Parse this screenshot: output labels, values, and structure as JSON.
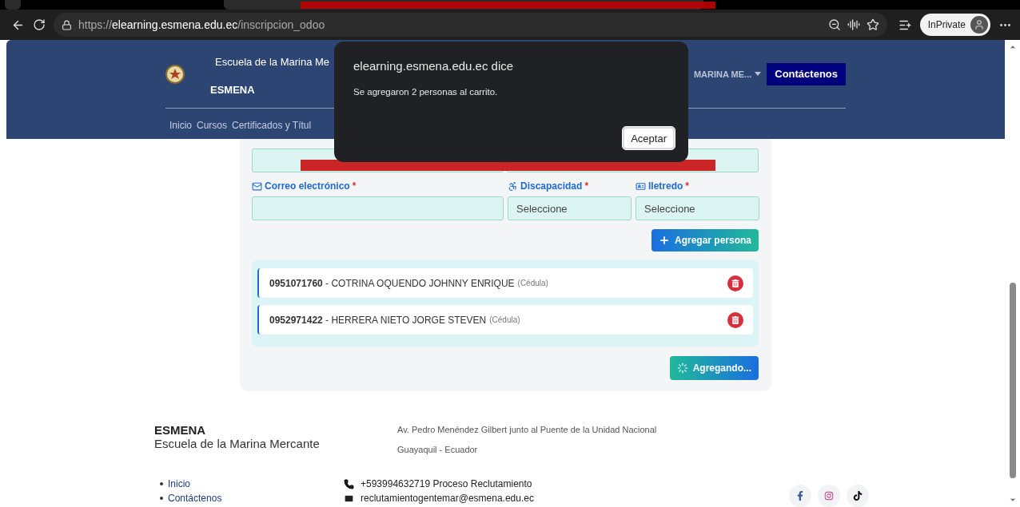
{
  "browser": {
    "url": "https://**elearning.esmena.edu.ec**/inscripcion_odoo",
    "profile": "InPrivate"
  },
  "header": {
    "site_title": "Escuela de la Marina Me",
    "brand": "ESMENA",
    "dropdown": "MARINA ME...",
    "contact_button": "Contáctenos",
    "nav": [
      "Inicio",
      "Cursos",
      "Certificados y Títul"
    ]
  },
  "form": {
    "top_inputs": [
      {
        "kind": "text"
      },
      {
        "kind": "text"
      }
    ],
    "fields": [
      {
        "kind": "email",
        "label": "Correo electrónico",
        "mark": "*"
      },
      {
        "kind": "disability",
        "label": "Discapacidad",
        "mark": "*",
        "value": "Seleccione"
      },
      {
        "kind": "illiterate",
        "label": "Iletredo",
        "mark": "*",
        "value": "Seleccione"
      }
    ],
    "add_button": "Agregar persona",
    "persons": [
      {
        "text": "**0951071760** - COTRINA OQUENDO JOHNNY ENRIQUE",
        "doc_type": "(Cédula)"
      },
      {
        "text": "**0952971422** - HERRERA NIETO JORGE STEVEN",
        "doc_type": "(Cédula)"
      }
    ],
    "submit_button": {
      "label": "Agregando...",
      "busy": true
    }
  },
  "footer": {
    "brand": "ESMENA",
    "subtitle": "Escuela de la Marina Mercante",
    "address": [
      "Av. Pedro Menéndez Gilbert junto al Puente de la Unidad Nacional",
      "Guayaquil - Ecuador"
    ],
    "links": [
      "Inicio",
      "Contáctenos"
    ],
    "contacts": [
      {
        "kind": "phone",
        "text": "+593994632719 Proceso Reclutamiento"
      },
      {
        "kind": "email",
        "text": "reclutamientogentemar@esmena.edu.ec"
      }
    ],
    "social": [
      {
        "kind": "facebook"
      },
      {
        "kind": "instagram"
      },
      {
        "kind": "tiktok"
      }
    ]
  },
  "dialog": {
    "title": "elearning.esmena.edu.ec dice",
    "message": "Se agregaron 2 personas al carrito.",
    "button": "Aceptar"
  }
}
